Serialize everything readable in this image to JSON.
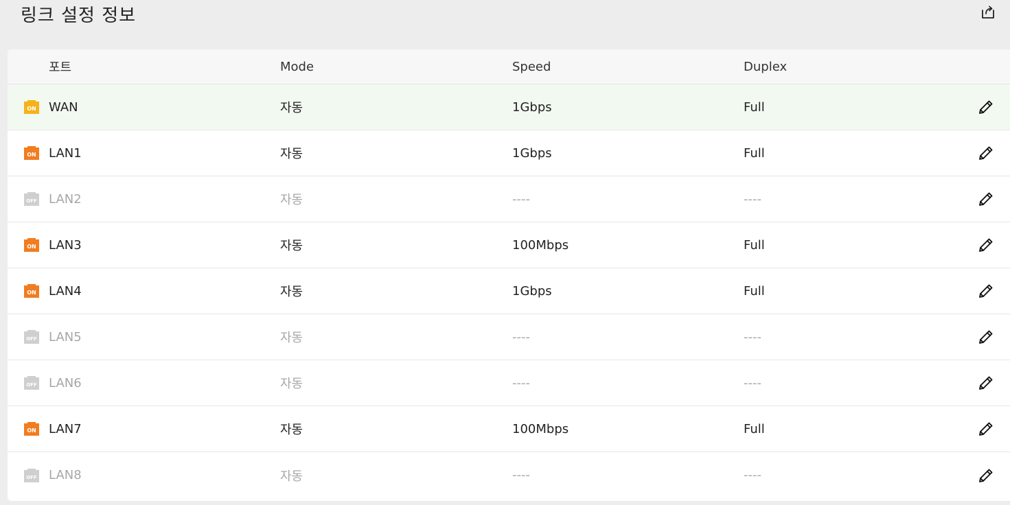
{
  "page": {
    "title": "링크 설정 정보"
  },
  "icons": {
    "export": "export-icon",
    "edit": "pencil-icon"
  },
  "colors": {
    "on_wan": "#f5b21a",
    "on_lan": "#f27c20",
    "off": "#cfcfcf",
    "highlight_row": "#f2f9f1"
  },
  "table": {
    "headers": {
      "port": "포트",
      "mode": "Mode",
      "speed": "Speed",
      "duplex": "Duplex"
    },
    "rows": [
      {
        "status": "ON",
        "port": "WAN",
        "mode": "자동",
        "speed": "1Gbps",
        "duplex": "Full"
      },
      {
        "status": "ON",
        "port": "LAN1",
        "mode": "자동",
        "speed": "1Gbps",
        "duplex": "Full"
      },
      {
        "status": "OFF",
        "port": "LAN2",
        "mode": "자동",
        "speed": "----",
        "duplex": "----"
      },
      {
        "status": "ON",
        "port": "LAN3",
        "mode": "자동",
        "speed": "100Mbps",
        "duplex": "Full"
      },
      {
        "status": "ON",
        "port": "LAN4",
        "mode": "자동",
        "speed": "1Gbps",
        "duplex": "Full"
      },
      {
        "status": "OFF",
        "port": "LAN5",
        "mode": "자동",
        "speed": "----",
        "duplex": "----"
      },
      {
        "status": "OFF",
        "port": "LAN6",
        "mode": "자동",
        "speed": "----",
        "duplex": "----"
      },
      {
        "status": "ON",
        "port": "LAN7",
        "mode": "자동",
        "speed": "100Mbps",
        "duplex": "Full"
      },
      {
        "status": "OFF",
        "port": "LAN8",
        "mode": "자동",
        "speed": "----",
        "duplex": "----"
      }
    ]
  }
}
